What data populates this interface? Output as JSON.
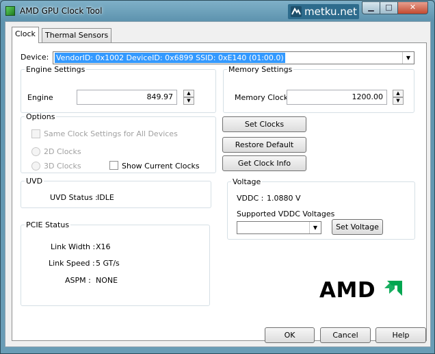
{
  "window": {
    "title": "AMD GPU Clock Tool",
    "brand": "metku.net",
    "minimize_glyph": "▁",
    "maximize_glyph": "□",
    "close_glyph": "✕"
  },
  "tabs": [
    {
      "label": "Clock",
      "active": true
    },
    {
      "label": "Thermal Sensors",
      "active": false
    }
  ],
  "device": {
    "label": "Device:",
    "value": "VendorID: 0x1002 DeviceID: 0x6899 SSID: 0xE140 (01:00.0)"
  },
  "engine_settings": {
    "title": "Engine Settings",
    "engine_label": "Engine",
    "engine_value": "849.97"
  },
  "memory_settings": {
    "title": "Memory Settings",
    "memory_label": "Memory Clock",
    "memory_value": "1200.00"
  },
  "options": {
    "title": "Options",
    "same_clock": "Same Clock Settings for All Devices",
    "clocks_2d": "2D Clocks",
    "clocks_3d": "3D Clocks",
    "show_current": "Show Current Clocks"
  },
  "actions": {
    "set_clocks": "Set Clocks",
    "restore_defaults": "Restore Default Clocks",
    "get_clock_info": "Get Clock Info"
  },
  "uvd": {
    "title": "UVD",
    "status_label": "UVD Status :",
    "status_value": "IDLE"
  },
  "voltage": {
    "title": "Voltage",
    "vddc_label": "VDDC :",
    "vddc_value": "1.0880 V",
    "supported_label": "Supported VDDC Voltages",
    "supported_value": "",
    "set_voltage": "Set Voltage"
  },
  "pcie": {
    "title": "PCIE Status",
    "link_width_label": "Link Width :",
    "link_width_value": "X16",
    "link_speed_label": "Link Speed :",
    "link_speed_value": "5 GT/s",
    "aspm_label": "ASPM :",
    "aspm_value": "NONE"
  },
  "logo": {
    "text": "AMD"
  },
  "footer": {
    "ok": "OK",
    "cancel": "Cancel",
    "help": "Help"
  },
  "colors": {
    "selection": "#3399ff",
    "logo_green": "#00a650"
  }
}
